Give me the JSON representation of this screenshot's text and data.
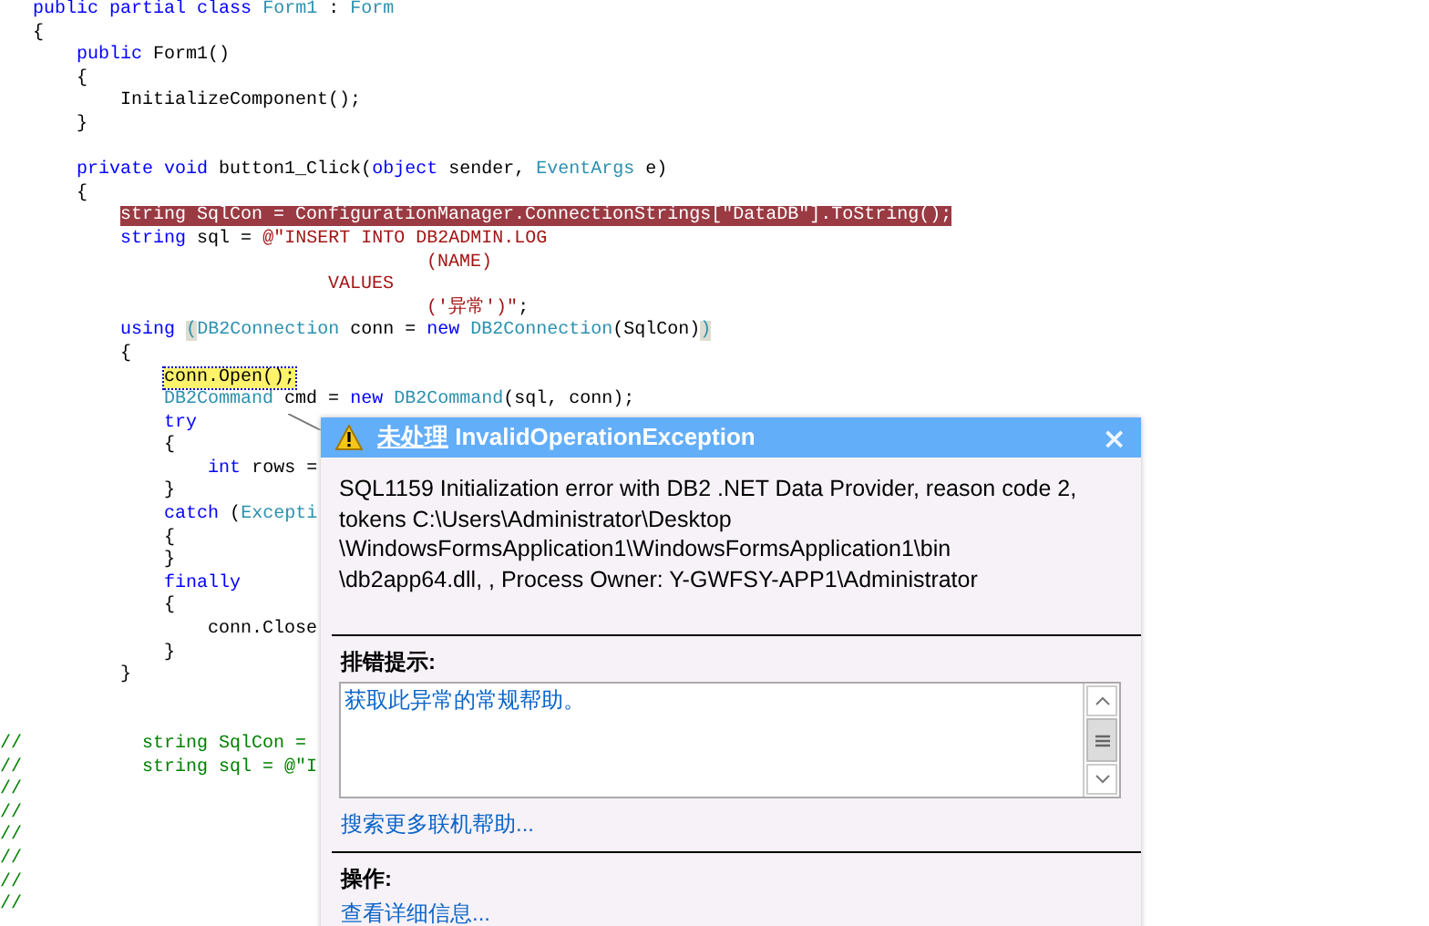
{
  "code": {
    "blocks": [
      {
        "lines": [
          {
            "segments": [
              {
                "text": "   public partial class",
                "kind": "keyword"
              },
              {
                "text": " Form1",
                "kind": "type"
              },
              {
                "text": " : ",
                "kind": "plain"
              },
              {
                "text": "Form",
                "kind": "type"
              }
            ]
          },
          {
            "segments": [
              {
                "text": "   {",
                "kind": "plain"
              }
            ]
          },
          {
            "segments": [
              {
                "text": "       public",
                "kind": "keyword"
              },
              {
                "text": " Form1()",
                "kind": "plain"
              }
            ]
          },
          {
            "segments": [
              {
                "text": "       {",
                "kind": "plain"
              }
            ]
          },
          {
            "segments": [
              {
                "text": "           InitializeComponent();",
                "kind": "plain"
              }
            ]
          },
          {
            "segments": [
              {
                "text": "       }",
                "kind": "plain"
              }
            ]
          }
        ]
      },
      {
        "lines": [
          {
            "segments": [
              {
                "text": "       private void",
                "kind": "keyword"
              },
              {
                "text": " button1_Click(",
                "kind": "plain"
              },
              {
                "text": "object",
                "kind": "keyword"
              },
              {
                "text": " sender, ",
                "kind": "plain"
              },
              {
                "text": "EventArgs",
                "kind": "type"
              },
              {
                "text": " e)",
                "kind": "plain"
              }
            ]
          },
          {
            "segments": [
              {
                "text": "       {",
                "kind": "plain"
              }
            ]
          },
          {
            "segments": [
              {
                "text": "           string SqlCon = ConfigurationManager.ConnectionStrings[\"DataDB\"].ToString();",
                "kind": "error"
              }
            ]
          },
          {
            "segments": [
              {
                "text": "           string",
                "kind": "keyword"
              },
              {
                "text": " sql = ",
                "kind": "plain"
              },
              {
                "text": "@\"INSERT INTO DB2ADMIN.LOG",
                "kind": "string"
              }
            ]
          },
          {
            "segments": [
              {
                "text": "                                       (NAME)",
                "kind": "string"
              }
            ]
          },
          {
            "segments": [
              {
                "text": "                              VALUES",
                "kind": "string"
              }
            ]
          },
          {
            "segments": [
              {
                "text": "                                       ('异常')\"",
                "kind": "string"
              },
              {
                "text": ";",
                "kind": "plain"
              }
            ]
          },
          {
            "segments": [
              {
                "text": "           using",
                "kind": "keyword"
              },
              {
                "text": " (",
                "kind": "match"
              },
              {
                "text": "DB2Connection",
                "kind": "type"
              },
              {
                "text": " conn = ",
                "kind": "plain"
              },
              {
                "text": "new",
                "kind": "keyword"
              },
              {
                "text": " DB2Connection",
                "kind": "type"
              },
              {
                "text": "(SqlCon)",
                "kind": "plain"
              },
              {
                "text": ")",
                "kind": "match"
              }
            ]
          },
          {
            "segments": [
              {
                "text": "           {",
                "kind": "plain"
              }
            ]
          },
          {
            "segments": [
              {
                "text": "               conn.Open();",
                "kind": "current"
              }
            ]
          },
          {
            "segments": [
              {
                "text": "               DB2Command",
                "kind": "type"
              },
              {
                "text": " cmd = ",
                "kind": "plain"
              },
              {
                "text": "new",
                "kind": "keyword"
              },
              {
                "text": " DB2Command",
                "kind": "type"
              },
              {
                "text": "(sql, conn);",
                "kind": "plain"
              }
            ]
          },
          {
            "segments": [
              {
                "text": "               try",
                "kind": "keyword"
              }
            ]
          },
          {
            "segments": [
              {
                "text": "               {",
                "kind": "plain"
              }
            ]
          },
          {
            "segments": [
              {
                "text": "                   int",
                "kind": "keyword"
              },
              {
                "text": " rows =",
                "kind": "plain"
              }
            ]
          },
          {
            "segments": [
              {
                "text": "               }",
                "kind": "plain"
              }
            ]
          },
          {
            "segments": [
              {
                "text": "               catch",
                "kind": "keyword"
              },
              {
                "text": " (",
                "kind": "plain"
              },
              {
                "text": "Excepti",
                "kind": "type"
              }
            ]
          },
          {
            "segments": [
              {
                "text": "               {",
                "kind": "plain"
              }
            ]
          },
          {
            "segments": [
              {
                "text": "               }",
                "kind": "plain"
              }
            ]
          },
          {
            "segments": [
              {
                "text": "               finally",
                "kind": "keyword"
              }
            ]
          },
          {
            "segments": [
              {
                "text": "               {",
                "kind": "plain"
              }
            ]
          },
          {
            "segments": [
              {
                "text": "                   conn.Close",
                "kind": "plain"
              }
            ]
          },
          {
            "segments": [
              {
                "text": "               }",
                "kind": "plain"
              }
            ]
          },
          {
            "segments": [
              {
                "text": "           }",
                "kind": "plain"
              }
            ]
          }
        ]
      }
    ],
    "commented_out": [
      {
        "segments": [
          {
            "text": "//           string SqlCon =",
            "kind": "comment"
          }
        ]
      },
      {
        "segments": [
          {
            "text": "//           string sql = @\"I",
            "kind": "comment"
          }
        ]
      },
      {
        "segments": [
          {
            "text": "//",
            "kind": "comment"
          }
        ]
      },
      {
        "segments": [
          {
            "text": "//",
            "kind": "comment"
          }
        ]
      },
      {
        "segments": [
          {
            "text": "//",
            "kind": "comment"
          }
        ]
      },
      {
        "segments": [
          {
            "text": "//",
            "kind": "comment"
          }
        ]
      },
      {
        "segments": [
          {
            "text": "//",
            "kind": "comment"
          }
        ]
      },
      {
        "segments": [
          {
            "text": "//",
            "kind": "comment"
          }
        ]
      }
    ]
  },
  "exception_dialog": {
    "title_prefix": "未处理",
    "title": "InvalidOperationException",
    "close": "×",
    "message_lines": [
      "SQL1159  Initialization error with DB2 .NET Data Provider, reason code 2,",
      "tokens C:\\Users\\Administrator\\Desktop",
      "\\WindowsFormsApplication1\\WindowsFormsApplication1\\bin",
      "\\db2app64.dll, , Process Owner: Y-GWFSY-APP1\\Administrator"
    ],
    "tips_heading": "排错提示:",
    "tips": [
      "获取此异常的常规帮助。"
    ],
    "search_link": "搜索更多联机帮助...",
    "actions_heading": "操作:",
    "actions": [
      "查看详细信息..."
    ]
  }
}
